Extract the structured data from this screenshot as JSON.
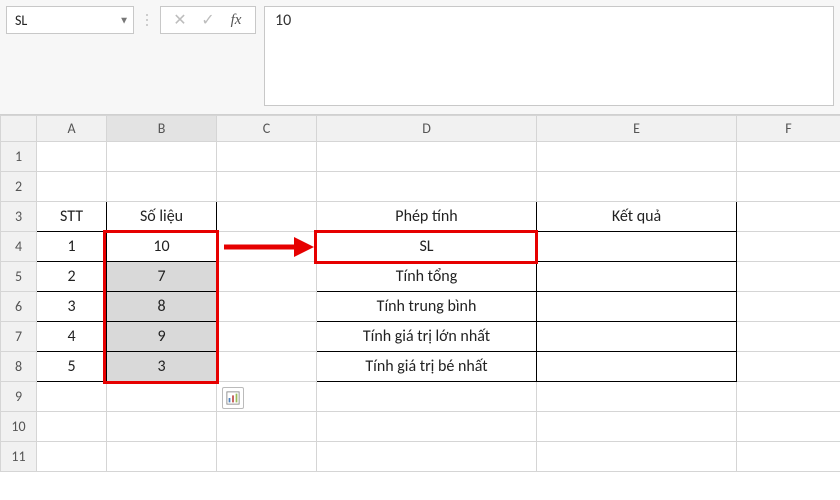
{
  "namebox": {
    "value": "SL"
  },
  "formula_bar": {
    "value": "10"
  },
  "col_headers": [
    "A",
    "B",
    "C",
    "D",
    "E",
    "F"
  ],
  "row_headers": [
    "1",
    "2",
    "3",
    "4",
    "5",
    "6",
    "7",
    "8",
    "9",
    "10",
    "11"
  ],
  "cells": {
    "A3": "STT",
    "B3": "Số liệu",
    "A4": "1",
    "B4": "10",
    "A5": "2",
    "B5": "7",
    "A6": "3",
    "B6": "8",
    "A7": "4",
    "B7": "9",
    "A8": "5",
    "B8": "3",
    "D3": "Phép tính",
    "E3": "Kết quả",
    "D4": "SL",
    "D5": "Tính tổng",
    "D6": "Tính trung bình",
    "D7": "Tính giá trị lớn nhất",
    "D8": "Tính giá trị bé nhất"
  },
  "fx_icons": {
    "cancel": "✕",
    "enter": "✓",
    "fx": "fx"
  },
  "annotations": {
    "highlight_source": "B4:B8",
    "highlight_target": "D4",
    "arrow_color": "#e60000"
  }
}
